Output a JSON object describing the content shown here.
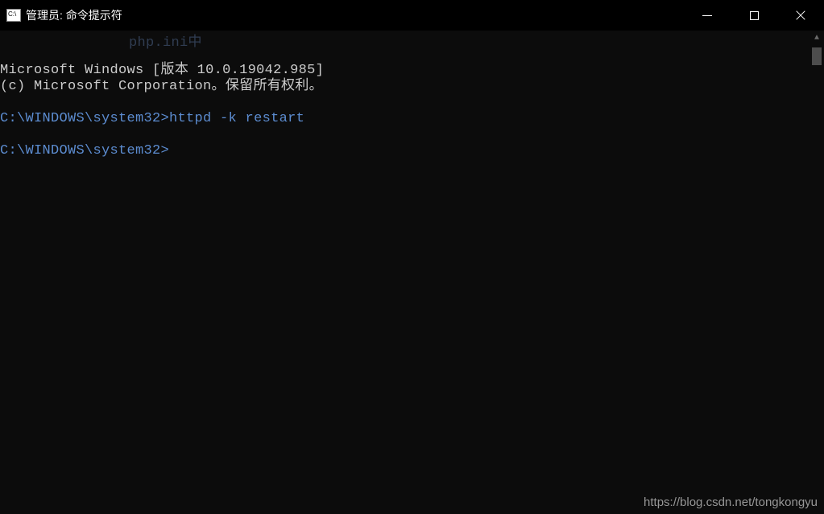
{
  "titlebar": {
    "title": "管理员: 命令提示符"
  },
  "terminal": {
    "bg_hint": "php.ini中",
    "version_line": "Microsoft Windows [版本 10.0.19042.985]",
    "copyright_line": "(c) Microsoft Corporation。保留所有权利。",
    "prompt1_path": "C:\\WINDOWS\\system32>",
    "prompt1_cmd": "httpd -k restart",
    "prompt2_path": "C:\\WINDOWS\\system32>"
  },
  "watermark": "https://blog.csdn.net/tongkongyu"
}
